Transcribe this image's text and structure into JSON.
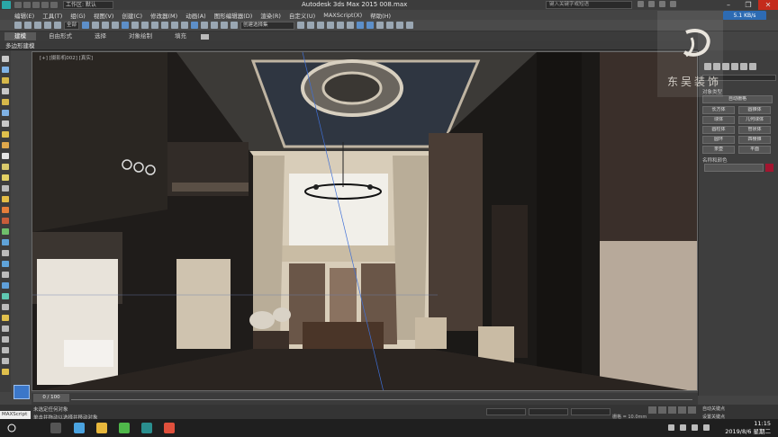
{
  "titlebar": {
    "workspace": "工作区: 默认",
    "title": "Autodesk 3ds Max  2015    008.max",
    "search_placeholder": "键入关键字或短语",
    "minimize": "–",
    "restore": "❐",
    "close": "✕"
  },
  "menu": [
    "编辑(E)",
    "工具(T)",
    "组(G)",
    "视图(V)",
    "创建(C)",
    "修改器(M)",
    "动画(A)",
    "图形编辑器(D)",
    "渲染(R)",
    "自定义(U)",
    "MAXScript(X)",
    "帮助(H)"
  ],
  "network": "5.1 KB/s",
  "ribbon": {
    "tabs": [
      "建模",
      "自由形式",
      "选择",
      "对象绘制",
      "填充"
    ],
    "active_tab": "建模",
    "sub_label": "多边形建模"
  },
  "toolbar": {
    "selection_filter": "全部",
    "named_set": "创建选择集"
  },
  "viewport": {
    "label": "[+] [摄影机002] [真实]"
  },
  "command_panel": {
    "section_object_type": "对象类型",
    "autogrid": "自动栅格",
    "buttons": [
      [
        "长方体",
        "圆锥体"
      ],
      [
        "球体",
        "几何球体"
      ],
      [
        "圆柱体",
        "管状体"
      ],
      [
        "圆环",
        "四棱锥"
      ],
      [
        "茶壶",
        "平面"
      ]
    ],
    "section_name_color": "名称和颜色",
    "swatch_color": "#a3152f"
  },
  "logo": {
    "text": "东吴装饰"
  },
  "timeline": {
    "frame": "0 / 100"
  },
  "status": {
    "line1": "未选定任何对象",
    "line2": "单击并拖动以选择并移动对象",
    "maxscript": "MAXScript",
    "grid": "栅格 = 10.0mm",
    "autokey": "自动关键点",
    "set_key": "设置关键点"
  },
  "taskbar": {
    "time": "11:15",
    "date": "2019/8/6 星期二"
  }
}
